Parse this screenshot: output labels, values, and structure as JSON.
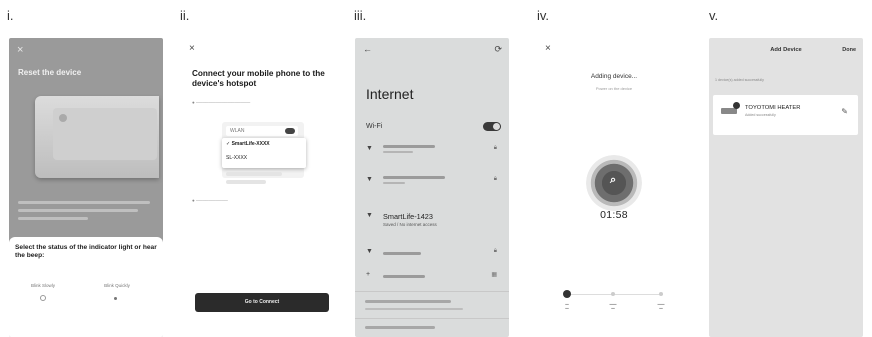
{
  "panels": [
    {
      "label": "i."
    },
    {
      "label": "ii."
    },
    {
      "label": "iii."
    },
    {
      "label": "iv."
    },
    {
      "label": "v."
    }
  ],
  "screen1": {
    "close": "×",
    "title": "Reset the device",
    "question": "Select the status of the indicator light or hear the beep:",
    "option_slow": "Blink Slowly",
    "option_quick": "Blink Quickly"
  },
  "screen2": {
    "close": "×",
    "title": "Connect your mobile phone to the device's hotspot",
    "wifi_label": "WLAN",
    "networks": [
      "✓ SmartLife-XXXX",
      "SL-XXXX"
    ],
    "button": "Go to Connect"
  },
  "screen3": {
    "title": "Internet",
    "wifi_label": "Wi-Fi",
    "highlight_network": "SmartLife-1423",
    "highlight_status": "Saved / No internet access",
    "accent": "#3a3a3a"
  },
  "screen4": {
    "close": "×",
    "title": "Adding device...",
    "subtitle": "Power on the device",
    "timer": "01:58"
  },
  "screen5": {
    "header": "Add Device",
    "done": "Done",
    "section": "1 device(s) added successfully",
    "device_name": "TOYOTOMI HEATER",
    "device_status": "Added successfully"
  }
}
